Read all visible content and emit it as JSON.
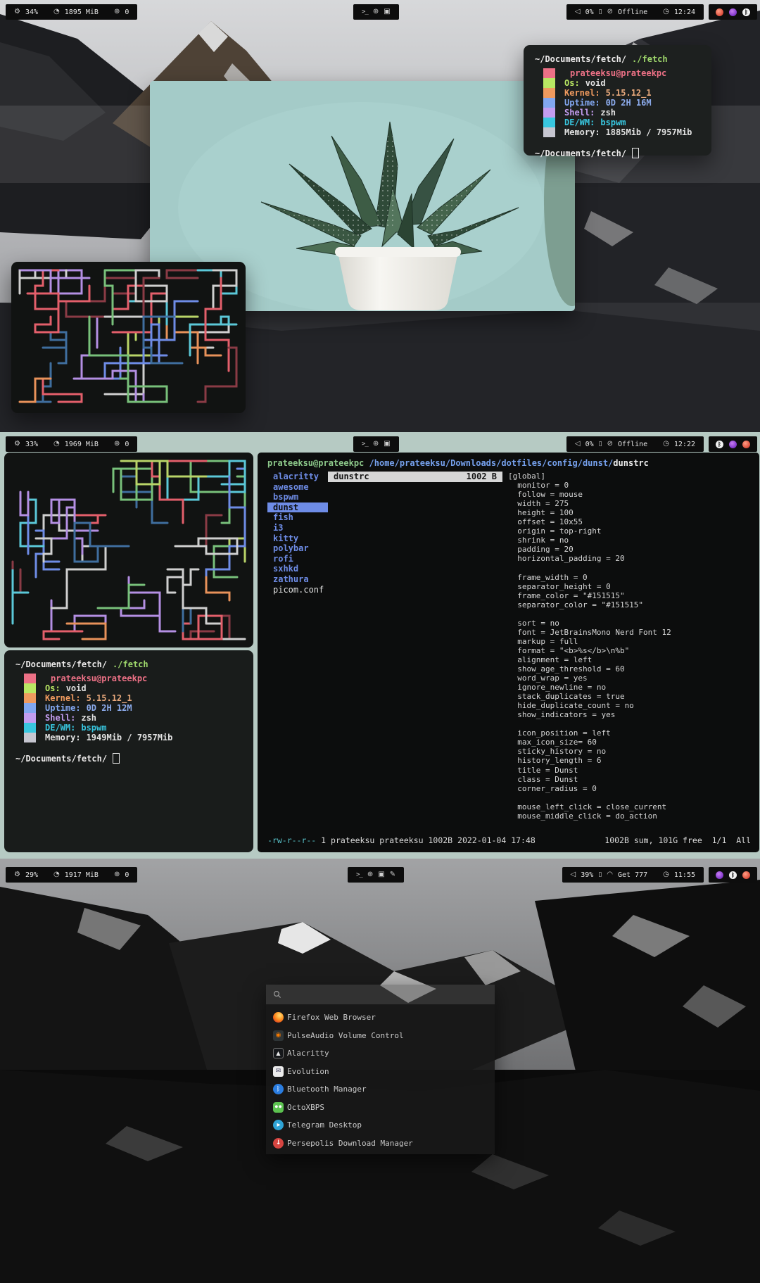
{
  "palette": {
    "accent_blue": "#6e8ce6",
    "sage_wallpaper": "#b6cac3",
    "terminal_bg": "#1d201f",
    "fetch_blocks": [
      "#ed7186",
      "#b9e763",
      "#ef9a5f",
      "#82a7f0",
      "#c39df0",
      "#38c6df",
      "#c6c6d0"
    ],
    "tray_red": "#e25744",
    "tray_purple": "#8a3fd1"
  },
  "polybars": [
    {
      "cpu": "34%",
      "memory": "1895 MiB",
      "packages": "0",
      "volume": "0%",
      "network": "Offline",
      "clock": "12:24"
    },
    {
      "cpu": "33%",
      "memory": "1969 MiB",
      "packages": "0",
      "volume": "0%",
      "network": "Offline",
      "clock": "12:22"
    },
    {
      "cpu": "29%",
      "memory": "1917 MiB",
      "packages": "0",
      "volume": "39%",
      "network": "Get 777",
      "clock": "11:55"
    }
  ],
  "fetch_windows": [
    {
      "prompt_path": "~/Documents/fetch/",
      "prompt_command": "./fetch",
      "lines": [
        {
          "label": "",
          "value": "prateeksu@prateekpc"
        },
        {
          "label": "Os:",
          "value": "void"
        },
        {
          "label": "Kernel:",
          "value": "5.15.12_1"
        },
        {
          "label": "Uptime:",
          "value": "0D 2H 16M"
        },
        {
          "label": "Shell:",
          "value": "zsh"
        },
        {
          "label": "DE/WM:",
          "value": "bspwm"
        },
        {
          "label": "Memory:",
          "value": "1885Mib / 7957Mib"
        }
      ]
    },
    {
      "prompt_path": "~/Documents/fetch/",
      "prompt_command": "./fetch",
      "lines": [
        {
          "label": "",
          "value": "prateeksu@prateekpc"
        },
        {
          "label": "Os:",
          "value": "void"
        },
        {
          "label": "Kernel:",
          "value": "5.15.12_1"
        },
        {
          "label": "Uptime:",
          "value": "0D 2H 12M"
        },
        {
          "label": "Shell:",
          "value": "zsh"
        },
        {
          "label": "DE/WM:",
          "value": "bspwm"
        },
        {
          "label": "Memory:",
          "value": "1949Mib / 7957Mib"
        }
      ]
    }
  ],
  "file_manager": {
    "host": "prateeksu@prateekpc",
    "path": "/home/prateeksu/Downloads/dotfiles/config/dunst/",
    "file": "dunstrc",
    "parent_entries": [
      "alacritty",
      "awesome",
      "bspwm",
      "dunst",
      "fish",
      "i3",
      "kitty",
      "polybar",
      "rofi",
      "sxhkd",
      "zathura",
      "picom.conf"
    ],
    "selected_index": 3,
    "selected_file": {
      "name": "dunstrc",
      "size": "1002 B"
    },
    "preview": [
      "[global]",
      "  monitor = 0",
      "  follow = mouse",
      "  width = 275",
      "  height = 100",
      "  offset = 10x55",
      "  origin = top-right",
      "  shrink = no",
      "  padding = 20",
      "  horizontal_padding = 20",
      "",
      "  frame_width = 0",
      "  separator_height = 0",
      "  frame_color = \"#151515\"",
      "  separator_color = \"#151515\"",
      "",
      "  sort = no",
      "  font = JetBrainsMono Nerd Font 12",
      "  markup = full",
      "  format = \"<b>%s</b>\\n%b\"",
      "  alignment = left",
      "  show_age_threshold = 60",
      "  word_wrap = yes",
      "  ignore_newline = no",
      "  stack_duplicates = true",
      "  hide_duplicate_count = no",
      "  show_indicators = yes",
      "",
      "  icon_position = left",
      "  max_icon_size= 60",
      "  sticky_history = no",
      "  history_length = 6",
      "  title = Dunst",
      "  class = Dunst",
      "  corner_radius = 0",
      "",
      "  mouse_left_click = close_current",
      "  mouse_middle_click = do_action"
    ],
    "status_perms": "-rw-r--r--",
    "status_left": " 1 prateeksu prateeksu 1002B 2022-01-04 17:48",
    "status_right": "1002B sum, 101G free  1/1  All"
  },
  "rofi": {
    "apps": [
      {
        "name": "Firefox Web Browser",
        "icon": "firefox"
      },
      {
        "name": "PulseAudio Volume Control",
        "icon": "pulseaudio"
      },
      {
        "name": "Alacritty",
        "icon": "alacritty"
      },
      {
        "name": "Evolution",
        "icon": "evolution"
      },
      {
        "name": "Bluetooth Manager",
        "icon": "bluetooth"
      },
      {
        "name": "OctoXBPS",
        "icon": "octoxbps"
      },
      {
        "name": "Telegram Desktop",
        "icon": "telegram"
      },
      {
        "name": "Persepolis Download Manager",
        "icon": "persepolis"
      }
    ]
  }
}
